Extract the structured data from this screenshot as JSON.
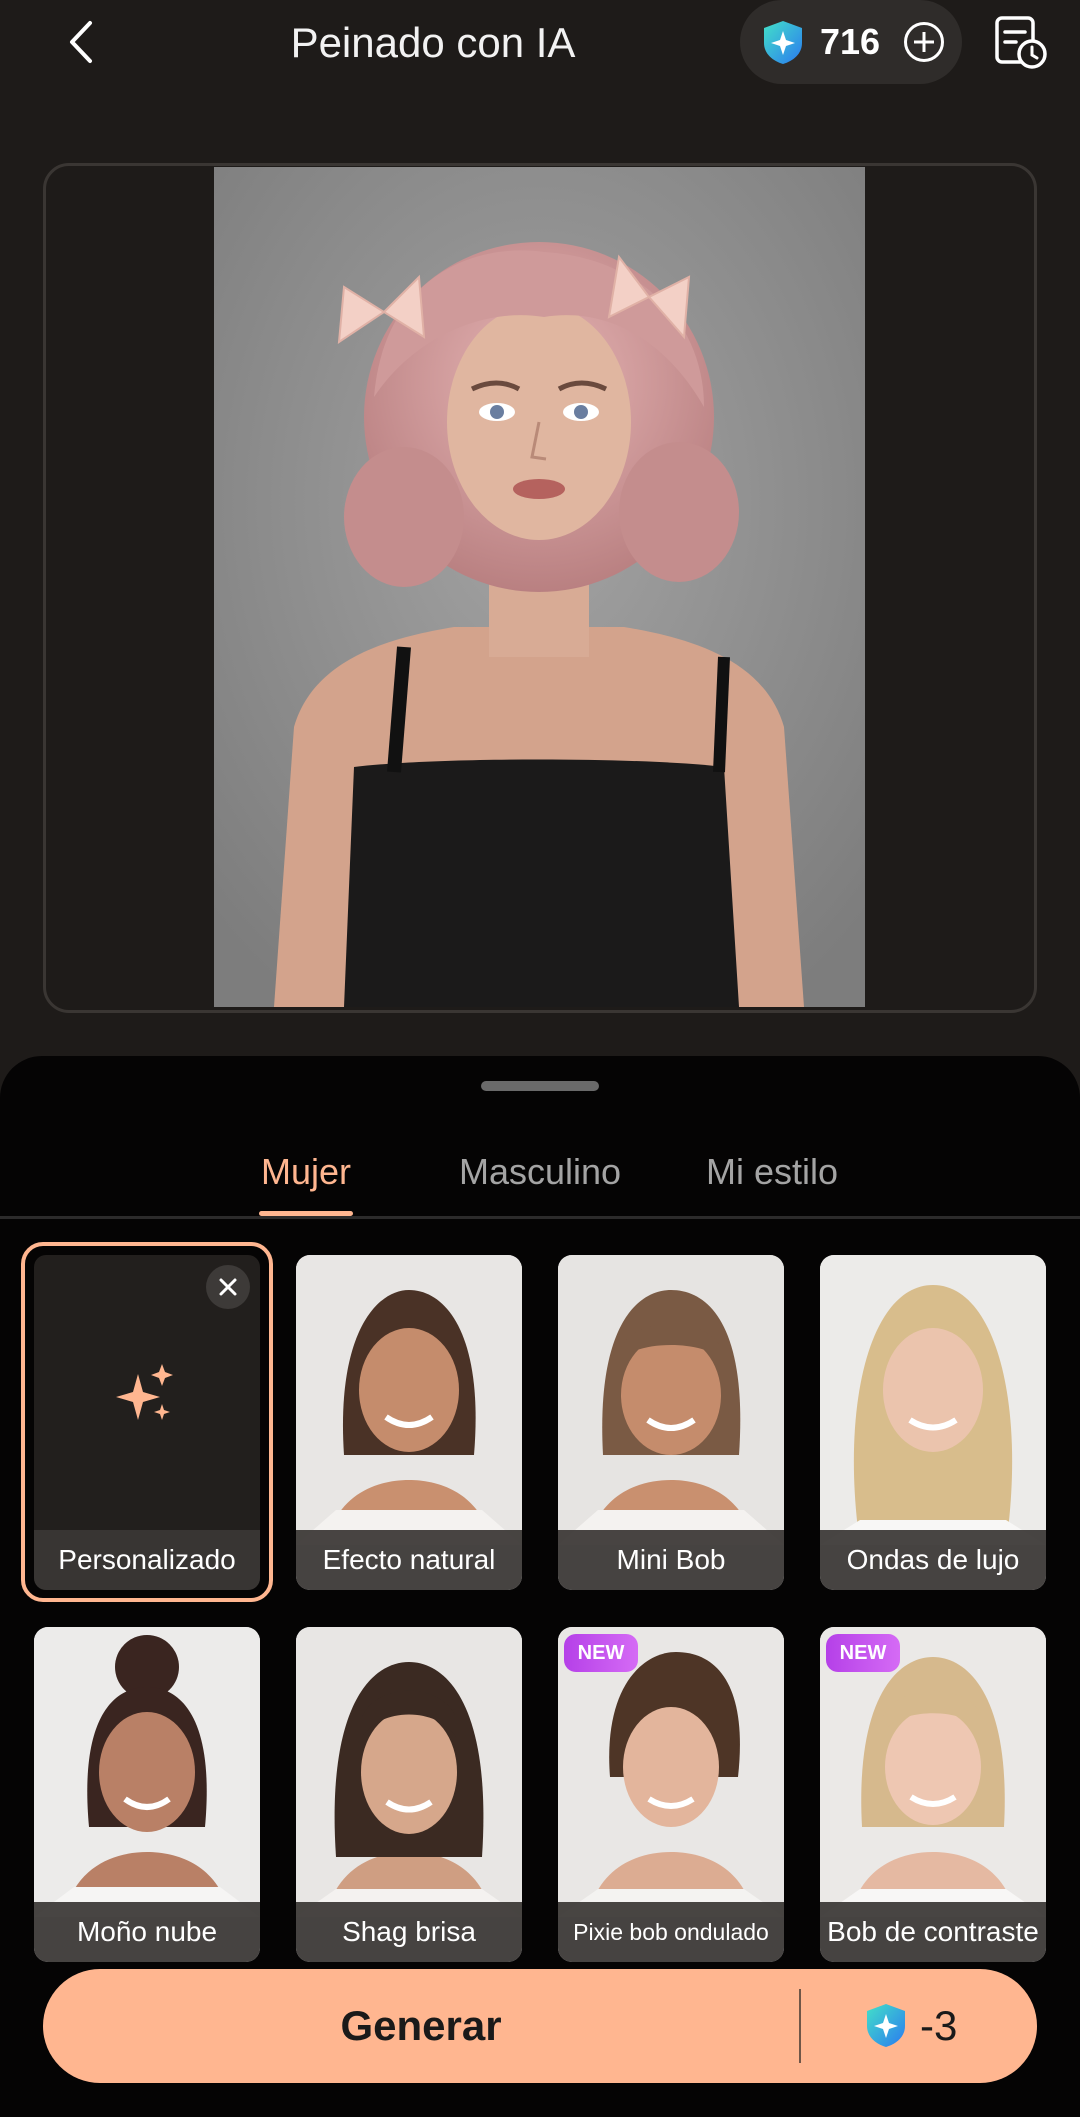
{
  "header": {
    "title": "Peinado con IA",
    "credits": "716"
  },
  "tabs": [
    {
      "label": "Mujer",
      "active": true
    },
    {
      "label": "Masculino",
      "active": false
    },
    {
      "label": "Mi estilo",
      "active": false
    }
  ],
  "styles": [
    {
      "label": "Personalizado",
      "selected": true,
      "badge": ""
    },
    {
      "label": "Efecto natural",
      "badge": ""
    },
    {
      "label": "Mini Bob",
      "badge": ""
    },
    {
      "label": "Ondas de lujo",
      "badge": ""
    },
    {
      "label": "Moño nube",
      "badge": ""
    },
    {
      "label": "Shag brisa",
      "badge": ""
    },
    {
      "label": "Pixie bob ondulado",
      "badge": "NEW"
    },
    {
      "label": "Bob de contraste",
      "badge": "NEW"
    }
  ],
  "generate": {
    "label": "Generar",
    "cost": "-3"
  },
  "colors": {
    "accent": "#ffb690",
    "background": "#1e1b19",
    "sheet": "#050404",
    "credit_blue": "#2aa7f0"
  }
}
